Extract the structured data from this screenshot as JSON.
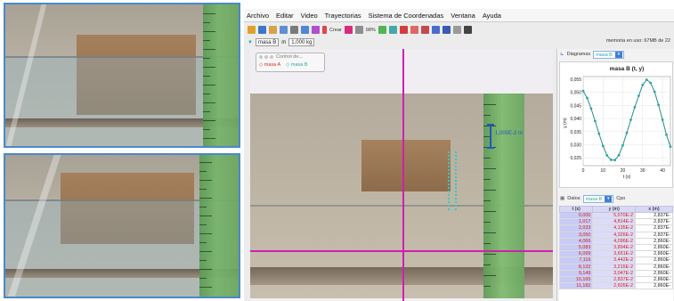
{
  "menu": [
    "Archivo",
    "Editar",
    "Video",
    "Trayectorias",
    "Sistema de Coordenadas",
    "Ventana",
    "Ayuda"
  ],
  "toolbar": {
    "create_label": "Crear",
    "zoom_label": "98%"
  },
  "mass_row": {
    "mass_name": "masa B",
    "mass_value": "1,000 kg",
    "memory": "memoria en uso: 67MB de 22"
  },
  "control_window": {
    "title": "Control de...",
    "items": [
      "masa A",
      "masa B"
    ]
  },
  "calibration": "1,000E-2 m",
  "plot_panel": {
    "tab_label": "Diagramas",
    "selected": "masa B",
    "title": "masa B (t, y)",
    "xlabel": "t (s)",
    "ylabel": "y (m)"
  },
  "data_panel": {
    "tab_label": "Datos",
    "selected": "masa B",
    "extra": "Cpo",
    "columns": [
      "t (s)",
      "y (m)",
      "x (m)"
    ],
    "rows": [
      [
        "0,000",
        "5,070E-2",
        "2,837E-"
      ],
      [
        "1,017",
        "4,814E-2",
        "2,837E-"
      ],
      [
        "2,033",
        "4,135E-2",
        "2,837E-"
      ],
      [
        "3,050",
        "4,326E-2",
        "2,837E-"
      ],
      [
        "4,066",
        "4,096E-2",
        "2,860E-"
      ],
      [
        "5,083",
        "3,894E-2",
        "2,860E-"
      ],
      [
        "6,099",
        "3,651E-2",
        "2,860E-"
      ],
      [
        "7,116",
        "3,442E-2",
        "2,860E-"
      ],
      [
        "8,132",
        "3,215E-2",
        "2,860E-"
      ],
      [
        "9,149",
        "3,047E-2",
        "2,860E-"
      ],
      [
        "10,165",
        "2,837E-2",
        "2,860E-"
      ],
      [
        "11,182",
        "2,605E-2",
        "2,860E-"
      ]
    ]
  },
  "colors": {
    "axis": "#d01fb0",
    "track": "#35c8c8",
    "mass_a": "#d42a2a",
    "mass_b": "#26a9a9",
    "calibration": "#2056c8",
    "selection": "#3f7fd8"
  },
  "chart_data": {
    "type": "line",
    "title": "masa B (t, y)",
    "xlabel": "t (s)",
    "ylabel": "y (m)",
    "xlim": [
      0,
      44
    ],
    "ylim": [
      0.022,
      0.056
    ],
    "x_ticks": [
      "0",
      "10",
      "20",
      "30",
      "40"
    ],
    "y_ticks": [
      "0,025",
      "0,030",
      "0,035",
      "0,040",
      "0,045",
      "0,050",
      "0,055"
    ],
    "series": [
      {
        "x": [
          0,
          2,
          4,
          6,
          8,
          10,
          12,
          14,
          16,
          18,
          20,
          22,
          24,
          26,
          28,
          30,
          32,
          34,
          36,
          38,
          40,
          42,
          44
        ],
        "y": [
          0.0505,
          0.0478,
          0.0438,
          0.039,
          0.0342,
          0.0295,
          0.0259,
          0.0242,
          0.0241,
          0.026,
          0.0298,
          0.0345,
          0.0395,
          0.0443,
          0.0487,
          0.0528,
          0.0548,
          0.0536,
          0.0502,
          0.0452,
          0.0395,
          0.0338,
          0.0292
        ]
      }
    ]
  }
}
